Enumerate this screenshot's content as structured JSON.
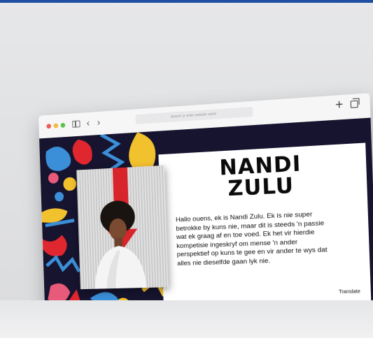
{
  "browser": {
    "address_placeholder": "Search or enter website name",
    "back_glyph": "‹",
    "forward_glyph": "›",
    "new_tab_glyph": "+"
  },
  "profile": {
    "name_line1": "NANDI",
    "name_line2": "ZULU",
    "bio": "Hallo ouens, ek is Nandi Zulu. Ek is nie super betrokke by kuns nie, maar dit is steeds 'n passie wat ek graag af en toe voed. Ek het vir hierdie kompetisie ingeskryf om mense 'n ander perspektief op kuns te gee en vir ander te wys dat alles nie dieselfde gaan lyk nie.",
    "translate_label": "Translate"
  },
  "colors": {
    "top_accent": "#1d4fa3",
    "art_background": "#16142e",
    "red": "#e0262e",
    "yellow": "#f2c12e",
    "blue": "#3b8fd9",
    "pink": "#e85a7a"
  },
  "icons": [
    "sidebar-icon",
    "back-icon",
    "forward-icon",
    "new-tab-icon",
    "tabs-overview-icon"
  ]
}
